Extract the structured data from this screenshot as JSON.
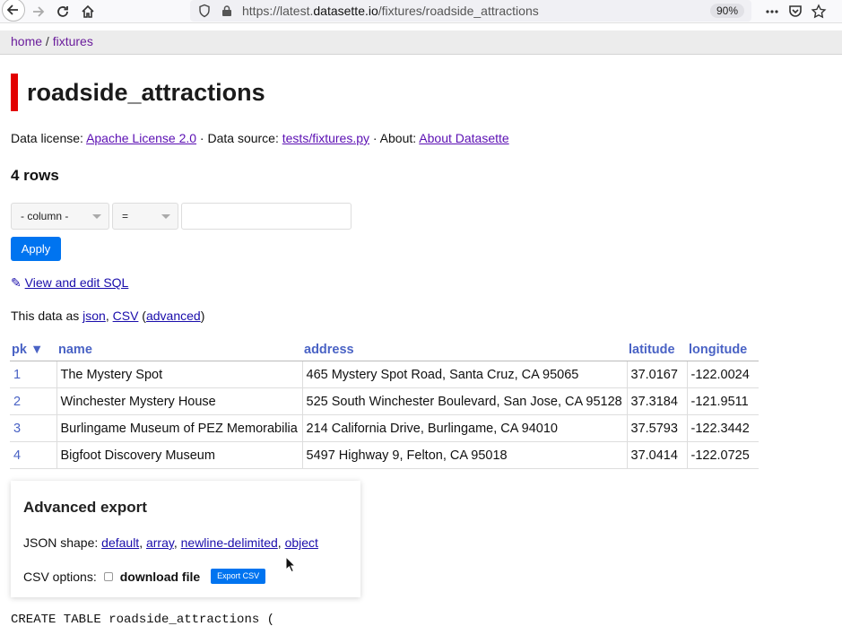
{
  "browser": {
    "url_prefix": "https://latest.",
    "url_host": "datasette.io",
    "url_path": "/fixtures/roadside_attractions",
    "zoom": "90%"
  },
  "breadcrumb": {
    "home": "home",
    "separator": " / ",
    "db": "fixtures"
  },
  "page": {
    "title": "roadside_attractions",
    "row_count": "4 rows"
  },
  "license": {
    "license_prefix": "Data license: ",
    "license_link": "Apache License 2.0",
    "source_prefix": " · Data source: ",
    "source_link": "tests/fixtures.py",
    "about_prefix": " · About: ",
    "about_link": "About Datasette"
  },
  "filters": {
    "column_select": "- column -",
    "op_select": "=",
    "value_placeholder": "",
    "apply_label": "Apply"
  },
  "sql_link": {
    "icon": "✎",
    "label": "View and edit SQL"
  },
  "as_data": {
    "prefix": "This data as ",
    "json": "json",
    "comma": ", ",
    "csv": "CSV",
    "open": " (",
    "advanced": "advanced",
    "close": ")"
  },
  "table": {
    "columns": [
      "pk ▼",
      "name",
      "address",
      "latitude",
      "longitude"
    ],
    "rows": [
      [
        "1",
        "The Mystery Spot",
        "465 Mystery Spot Road, Santa Cruz, CA 95065",
        "37.0167",
        "-122.0024"
      ],
      [
        "2",
        "Winchester Mystery House",
        "525 South Winchester Boulevard, San Jose, CA 95128",
        "37.3184",
        "-121.9511"
      ],
      [
        "3",
        "Burlingame Museum of PEZ Memorabilia",
        "214 California Drive, Burlingame, CA 94010",
        "37.5793",
        "-122.3442"
      ],
      [
        "4",
        "Bigfoot Discovery Museum",
        "5497 Highway 9, Felton, CA 95018",
        "37.0414",
        "-122.0725"
      ]
    ]
  },
  "advanced_export": {
    "heading": "Advanced export",
    "json_prefix": "JSON shape: ",
    "shape_default": "default",
    "shape_array": "array",
    "shape_newline": "newline-delimited",
    "shape_object": "object",
    "comma": ", ",
    "csv_prefix": "CSV options:",
    "download_label": "download file",
    "export_button": "Export CSV"
  },
  "sql_definition": "CREATE TABLE roadside_attractions ("
}
